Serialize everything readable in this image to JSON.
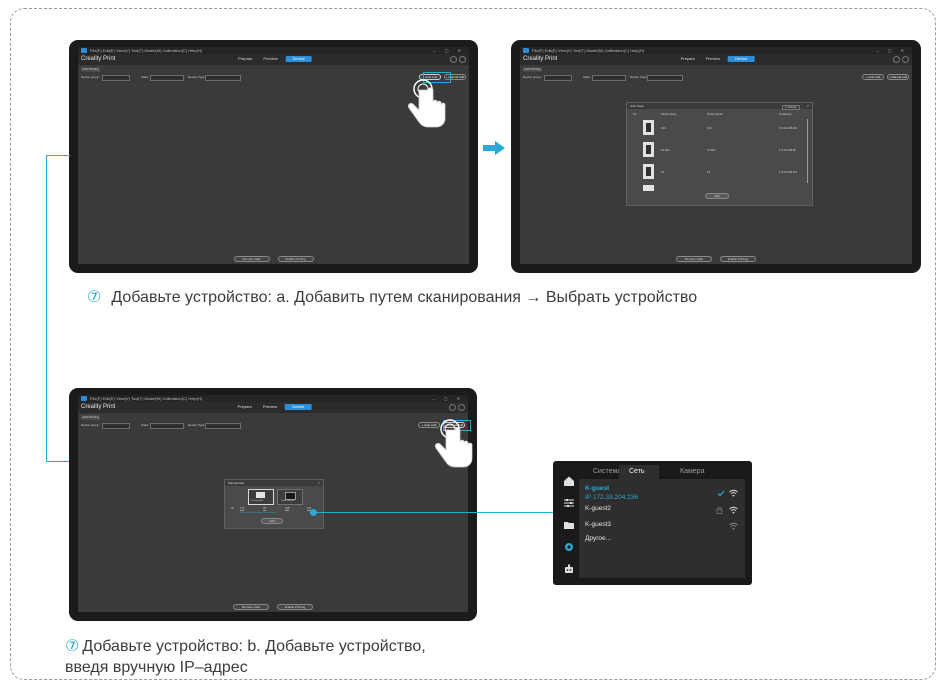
{
  "app": {
    "menu_text": "File(F)  Edit(E)  View(V)  Tool(T)  Model(M)  Calibration(C)  Help(H)",
    "window_controls": "– ▢ ✕",
    "title": "Creality Print",
    "tabs": [
      "Prepare",
      "Preview",
      "Device"
    ],
    "subtab": "LAN Printing",
    "filters": {
      "group_label": "Device group:",
      "group_value": "Default",
      "state_label": "State:",
      "state_value": "All",
      "type_label": "Device Type:",
      "type_value": "All"
    },
    "actions": {
      "auto_add": "+ Auto Add",
      "manual_add": "+ Manual Add"
    },
    "bottom_buttons": [
      "Remote Calls",
      "Enable Printing"
    ]
  },
  "scan_dialog": {
    "title": "Auto Scan",
    "refresh": "↻ Refresh",
    "headers": [
      "All",
      "Device Name",
      "Printer Model",
      "IP Address"
    ],
    "rows": [
      {
        "name": "K1C",
        "model": "K1C",
        "ip": "172.20.208.200"
      },
      {
        "name": "K1 Max",
        "model": "K1 Max",
        "ip": "172.20.208.58"
      },
      {
        "name": "K1",
        "model": "K1",
        "ip": "172.20.208.221"
      }
    ],
    "add_label": "Add"
  },
  "manual_dialog": {
    "title": "Manual Add",
    "options": [
      "Creality WiFi",
      "Open CB Box"
    ],
    "ip_label": "IP",
    "ip_parts": [
      "172",
      "20",
      "208",
      "221"
    ],
    "note": "Please enter the IP address of the device",
    "add_label": "Add"
  },
  "captions": {
    "a": {
      "num": "⑦",
      "text": "Добавьте устройство: a. Добавить путем сканирования → Выбрать устройство"
    },
    "b": {
      "num": "⑦",
      "line1": "Добавьте устройство: b. Добавьте устройство,",
      "line2": "введя вручную IP–адрес"
    }
  },
  "wifi_panel": {
    "tabs": [
      "Система",
      "Сеть",
      "Камера"
    ],
    "active_tab": "Сеть",
    "connected": {
      "name": "K-guest",
      "ip": "IP 172.33.204.236"
    },
    "networks": [
      "K-guest2",
      "K-guest3",
      "Другое..."
    ],
    "accent": "#2aa9d4"
  }
}
